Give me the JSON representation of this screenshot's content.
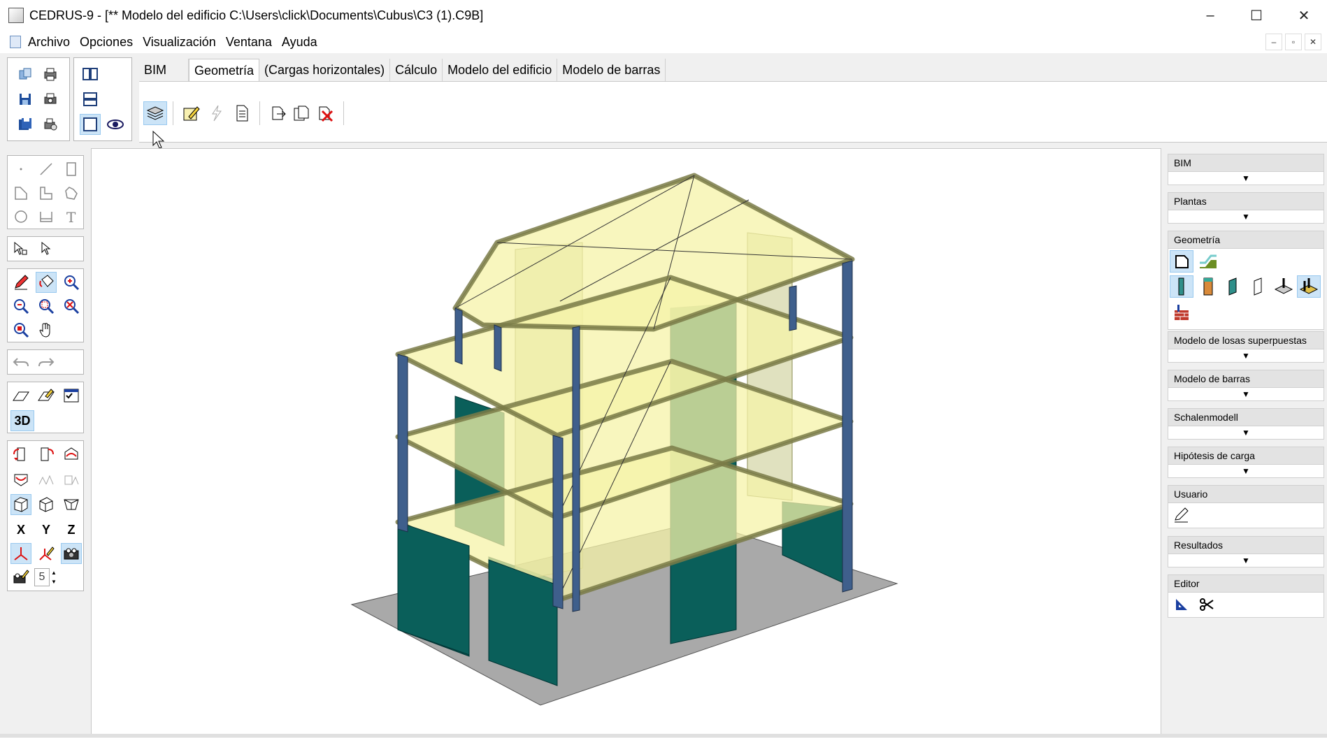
{
  "window": {
    "title": "CEDRUS-9 - [** Modelo del edificio  C:\\Users\\click\\Documents\\Cubus\\C3 (1).C9B]",
    "minimize": "–",
    "maximize": "☐",
    "close": "✕"
  },
  "menu": [
    "Archivo",
    "Opciones",
    "Visualización",
    "Ventana",
    "Ayuda"
  ],
  "mdi_buttons": [
    "–",
    "▫",
    "✕"
  ],
  "tabs": [
    "BIM",
    "Geometría",
    "(Cargas horizontales)",
    "Cálculo",
    "Modelo del edificio",
    "Modelo de barras"
  ],
  "active_tab": "Geometría",
  "tools": {
    "view_3d_label": "3D",
    "axis_x": "X",
    "axis_y": "Y",
    "axis_z": "Z",
    "spin_value": "5"
  },
  "right_panel": {
    "sections": [
      {
        "title": "BIM",
        "type": "dropdown"
      },
      {
        "title": "Plantas",
        "type": "dropdown"
      },
      {
        "title": "Geometría",
        "type": "icons"
      },
      {
        "title": "Modelo de losas superpuestas",
        "type": "dropdown"
      },
      {
        "title": "Modelo de barras",
        "type": "dropdown"
      },
      {
        "title": "Schalenmodell",
        "type": "dropdown"
      },
      {
        "title": "Hipótesis de carga",
        "type": "dropdown"
      },
      {
        "title": "Usuario",
        "type": "icons"
      },
      {
        "title": "Resultados",
        "type": "dropdown"
      },
      {
        "title": "Editor",
        "type": "icons"
      }
    ]
  },
  "colors": {
    "slab": "#f6f3a8",
    "wall": "#0a5f5a",
    "column": "#3f5f8c",
    "ground": "#a9a9a9",
    "selection": "#cce4f7"
  }
}
